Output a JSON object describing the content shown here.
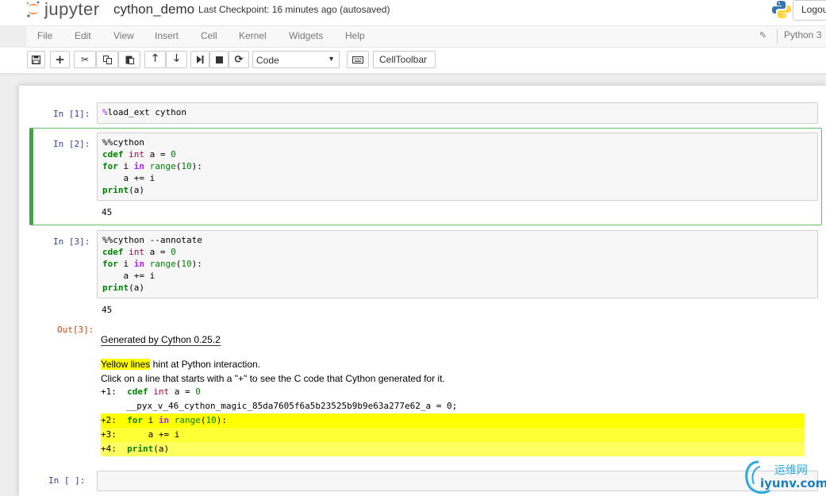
{
  "header": {
    "logo_text": "jupyter",
    "notebook_name": "cython_demo",
    "checkpoint": "Last Checkpoint: 16 minutes ago (autosaved)",
    "logout": "Logout"
  },
  "menu": {
    "items": [
      "File",
      "Edit",
      "View",
      "Insert",
      "Cell",
      "Kernel",
      "Widgets",
      "Help"
    ],
    "kernel_indicator": "Python 3"
  },
  "toolbar": {
    "cell_type": "Code",
    "celltoolbar_label": "CellToolbar",
    "buttons": [
      "save-icon",
      "plus-icon",
      "cut-icon",
      "copy-icon",
      "paste-icon",
      "arrow-up-icon",
      "arrow-down-icon",
      "run-icon",
      "stop-icon",
      "restart-icon",
      "keyboard-icon"
    ]
  },
  "cells": [
    {
      "prompt": "In  [1]:",
      "lines": [
        "%load_ext cython"
      ]
    },
    {
      "prompt": "In  [2]:",
      "lines": [
        "%%cython",
        "cdef int a = 0",
        "for i in range(10):",
        "    a += i",
        "print(a)"
      ],
      "output": "45"
    },
    {
      "prompt": "In  [3]:",
      "lines": [
        "%%cython --annotate",
        "cdef int a = 0",
        "for i in range(10):",
        "    a += i",
        "print(a)"
      ],
      "output": "45"
    },
    {
      "prompt": "In  [ ]:",
      "lines": []
    }
  ],
  "out3": {
    "prompt": "Out[3]:",
    "generated": "Generated by Cython 0.25.2",
    "yellow": "Yellow lines",
    "hint_rest": " hint at Python interaction.",
    "click_hint": "Click on a line that starts with a \"+\" to see the C code that Cython generated for it.",
    "annot_lines": [
      {
        "prefix": "+1:",
        "code": "cdef int a = 0",
        "level": 0
      },
      {
        "prefix": "",
        "code": "__pyx_v_46_cython_magic_85da7605f6a5b23525b9b9e63a277e62_a = 0;",
        "level": -1
      },
      {
        "prefix": "+2:",
        "code": "for i in range(10):",
        "level": 2
      },
      {
        "prefix": "+3:",
        "code": "    a += i",
        "level": 3
      },
      {
        "prefix": "+4:",
        "code": "print(a)",
        "level": 4
      }
    ]
  },
  "watermark": {
    "cn": "运维网",
    "url": "iyunv.com"
  },
  "colors": {
    "prompt_in": "#303f9f",
    "prompt_out": "#d84315",
    "selected_border": "#42a548",
    "highlight": "#ffff00"
  }
}
